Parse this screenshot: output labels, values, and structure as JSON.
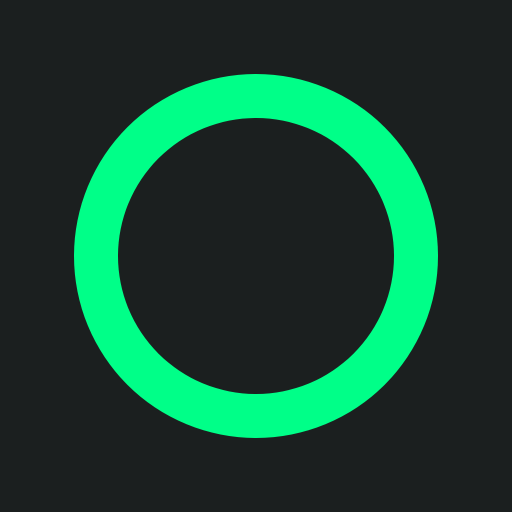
{
  "screen": {
    "background_color": "#1b1f1f"
  },
  "ring_icon": {
    "icon": "ring-icon",
    "ring_color": "#00ff88",
    "center_color": "#1b1f1f"
  }
}
